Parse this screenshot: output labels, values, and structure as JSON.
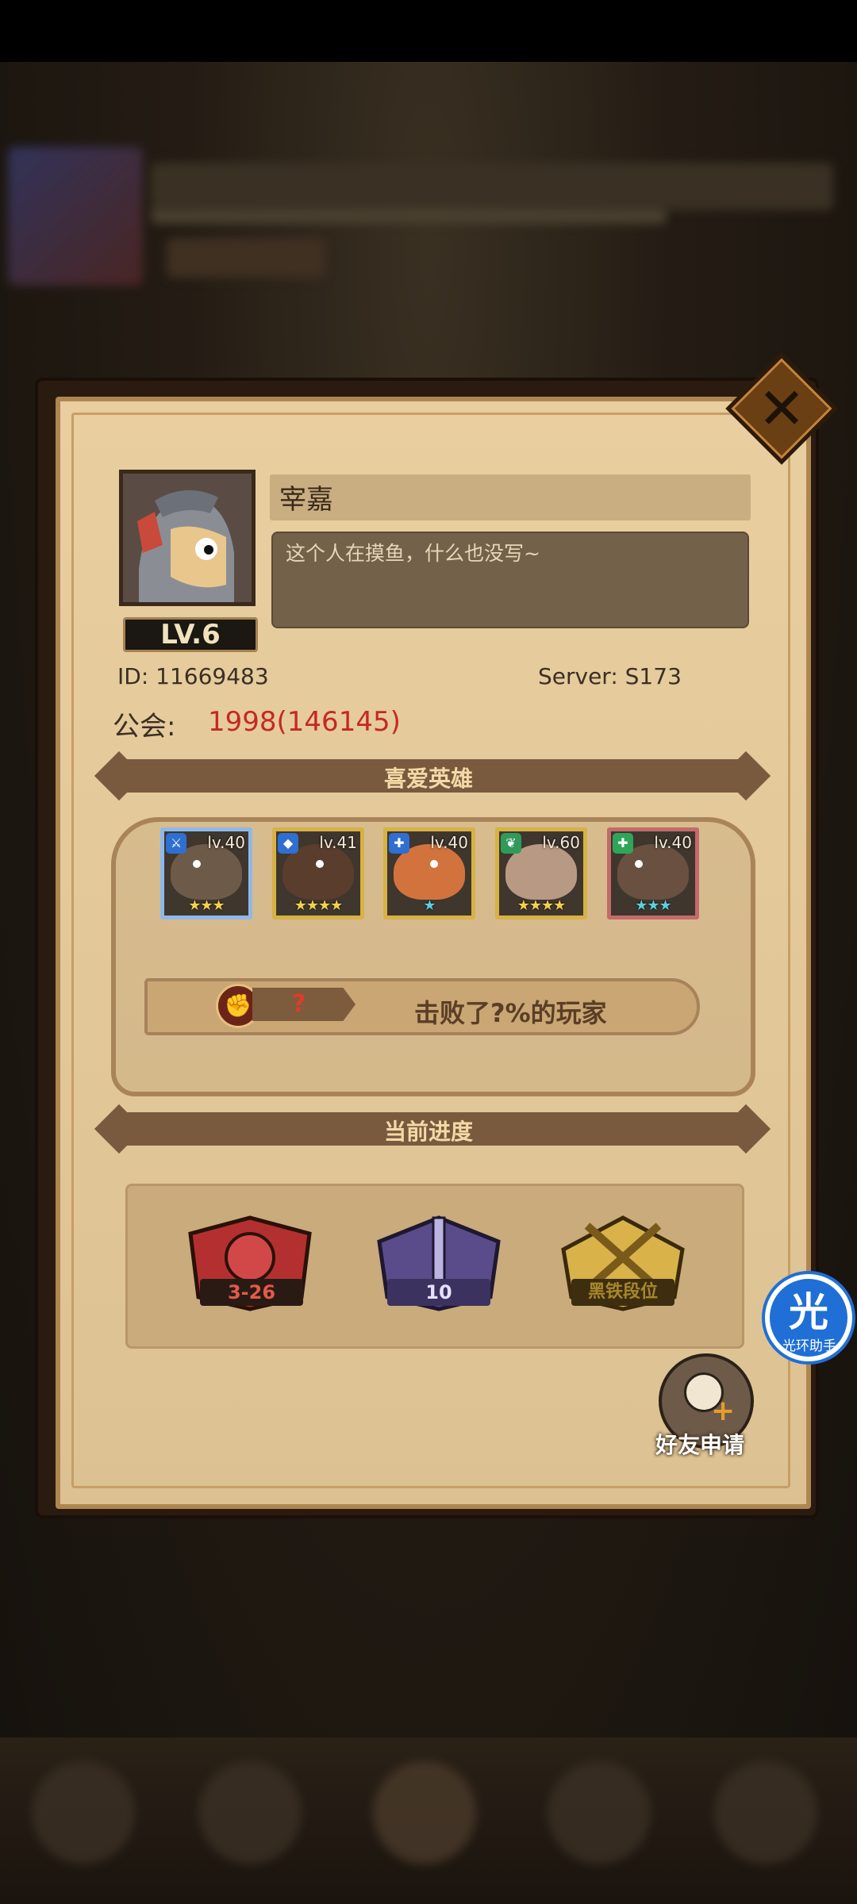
{
  "profile": {
    "name": "宰嘉",
    "signature": "这个人在摸鱼，什么也没写~",
    "level": "LV.6",
    "id_label": "ID:",
    "id_value": "11669483",
    "server": "Server: S173",
    "guild_label": "公会:",
    "guild_value": "1998(146145)"
  },
  "favorite_heroes": {
    "title": "喜爱英雄",
    "heroes": [
      {
        "level": "lv.40",
        "stars": "★★★",
        "class_icon": "sword-icon",
        "frame_color": "#8fb8e8"
      },
      {
        "level": "lv.41",
        "stars": "★★★★",
        "class_icon": "shield-icon",
        "frame_color": "#d7b244"
      },
      {
        "level": "lv.40",
        "stars": "★",
        "class_icon": "plus-icon",
        "frame_color": "#d7b244"
      },
      {
        "level": "lv.60",
        "stars": "★★★★",
        "class_icon": "leaf-icon",
        "frame_color": "#d7b244"
      },
      {
        "level": "lv.40",
        "stars": "★★★",
        "class_icon": "heal-icon",
        "frame_color": "#c46a6a"
      }
    ]
  },
  "defeat_rank": {
    "icon": "fist-icon",
    "value": "?",
    "text": "击败了?%的玩家"
  },
  "progress": {
    "title": "当前进度",
    "items": [
      {
        "label": "3-26",
        "color": "#c0392b"
      },
      {
        "label": "10",
        "color": "#6a5aa0"
      },
      {
        "label": "黑铁段位",
        "color": "#caa33c"
      }
    ]
  },
  "actions": {
    "friend_request": "好友申请",
    "assistant_glyph": "光",
    "assistant_label": "光环助手"
  },
  "colors": {
    "accent_red": "#c52727",
    "parchment": "#e8cc9a",
    "banner": "#7a5a3e"
  }
}
